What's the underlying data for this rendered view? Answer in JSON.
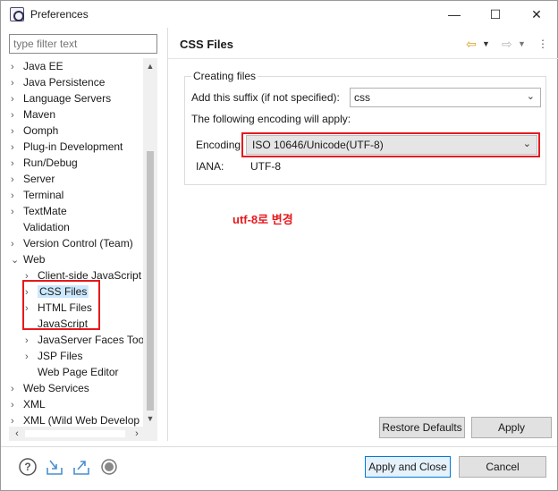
{
  "window": {
    "title": "Preferences",
    "min": "—",
    "max": "☐",
    "close": "✕"
  },
  "sidebar": {
    "filter_placeholder": "type filter text",
    "items": [
      {
        "label": "Java EE",
        "chev": "›"
      },
      {
        "label": "Java Persistence",
        "chev": "›"
      },
      {
        "label": "Language Servers",
        "chev": "›"
      },
      {
        "label": "Maven",
        "chev": "›"
      },
      {
        "label": "Oomph",
        "chev": "›"
      },
      {
        "label": "Plug-in Development",
        "chev": "›"
      },
      {
        "label": "Run/Debug",
        "chev": "›"
      },
      {
        "label": "Server",
        "chev": "›"
      },
      {
        "label": "Terminal",
        "chev": "›"
      },
      {
        "label": "TextMate",
        "chev": "›"
      },
      {
        "label": "Validation",
        "chev": ""
      },
      {
        "label": "Version Control (Team)",
        "chev": "›"
      },
      {
        "label": "Web",
        "chev": "⌄"
      },
      {
        "label": "Client-side JavaScript",
        "chev": "›"
      },
      {
        "label": "CSS Files",
        "chev": "›"
      },
      {
        "label": "HTML Files",
        "chev": "›"
      },
      {
        "label": "JavaScript",
        "chev": ""
      },
      {
        "label": "JavaServer Faces Tool",
        "chev": "›"
      },
      {
        "label": "JSP Files",
        "chev": "›"
      },
      {
        "label": "Web Page Editor",
        "chev": ""
      },
      {
        "label": "Web Services",
        "chev": "›"
      },
      {
        "label": "XML",
        "chev": "›"
      },
      {
        "label": "XML (Wild Web Develop",
        "chev": "›"
      }
    ]
  },
  "main": {
    "title": "CSS Files",
    "group_title": "Creating files",
    "suffix_label": "Add this suffix (if not specified):",
    "suffix_value": "css",
    "encoding_note": "The following encoding will apply:",
    "encoding_label": "Encoding:",
    "encoding_value": "ISO 10646/Unicode(UTF-8)",
    "iana_label": "IANA:",
    "iana_value": "UTF-8",
    "annotation": "utf-8로 변경"
  },
  "buttons": {
    "restore_defaults": "Restore Defaults",
    "apply": "Apply",
    "apply_close": "Apply and Close",
    "cancel": "Cancel"
  },
  "colors": {
    "annotation_red": "#e6191e",
    "selection": "#cce8ff",
    "primary_border": "#0078d7"
  }
}
